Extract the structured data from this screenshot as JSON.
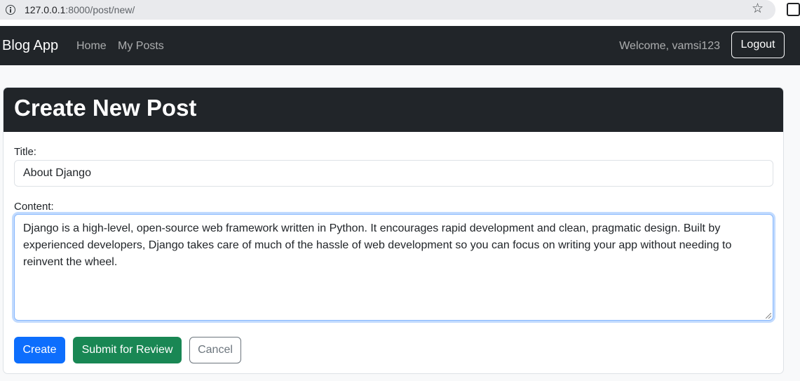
{
  "browser": {
    "url_host": "127.0.0.1",
    "url_rest": ":8000/post/new/"
  },
  "navbar": {
    "brand": "Blog App",
    "links": [
      "Home",
      "My Posts"
    ],
    "welcome": "Welcome, vamsi123",
    "logout_label": "Logout"
  },
  "card": {
    "title": "Create New Post"
  },
  "form": {
    "title_label": "Title:",
    "title_value": "About Django",
    "content_label": "Content:",
    "content_value": "Django is a high-level, open-source web framework written in Python. It encourages rapid development and clean, pragmatic design. Built by experienced developers, Django takes care of much of the hassle of web development so you can focus on writing your app without needing to reinvent the wheel."
  },
  "actions": {
    "create_label": "Create",
    "submit_label": "Submit for Review",
    "cancel_label": "Cancel"
  },
  "colors": {
    "navbar_bg": "#212529",
    "primary": "#0d6efd",
    "success": "#198754",
    "secondary": "#6c757d"
  }
}
